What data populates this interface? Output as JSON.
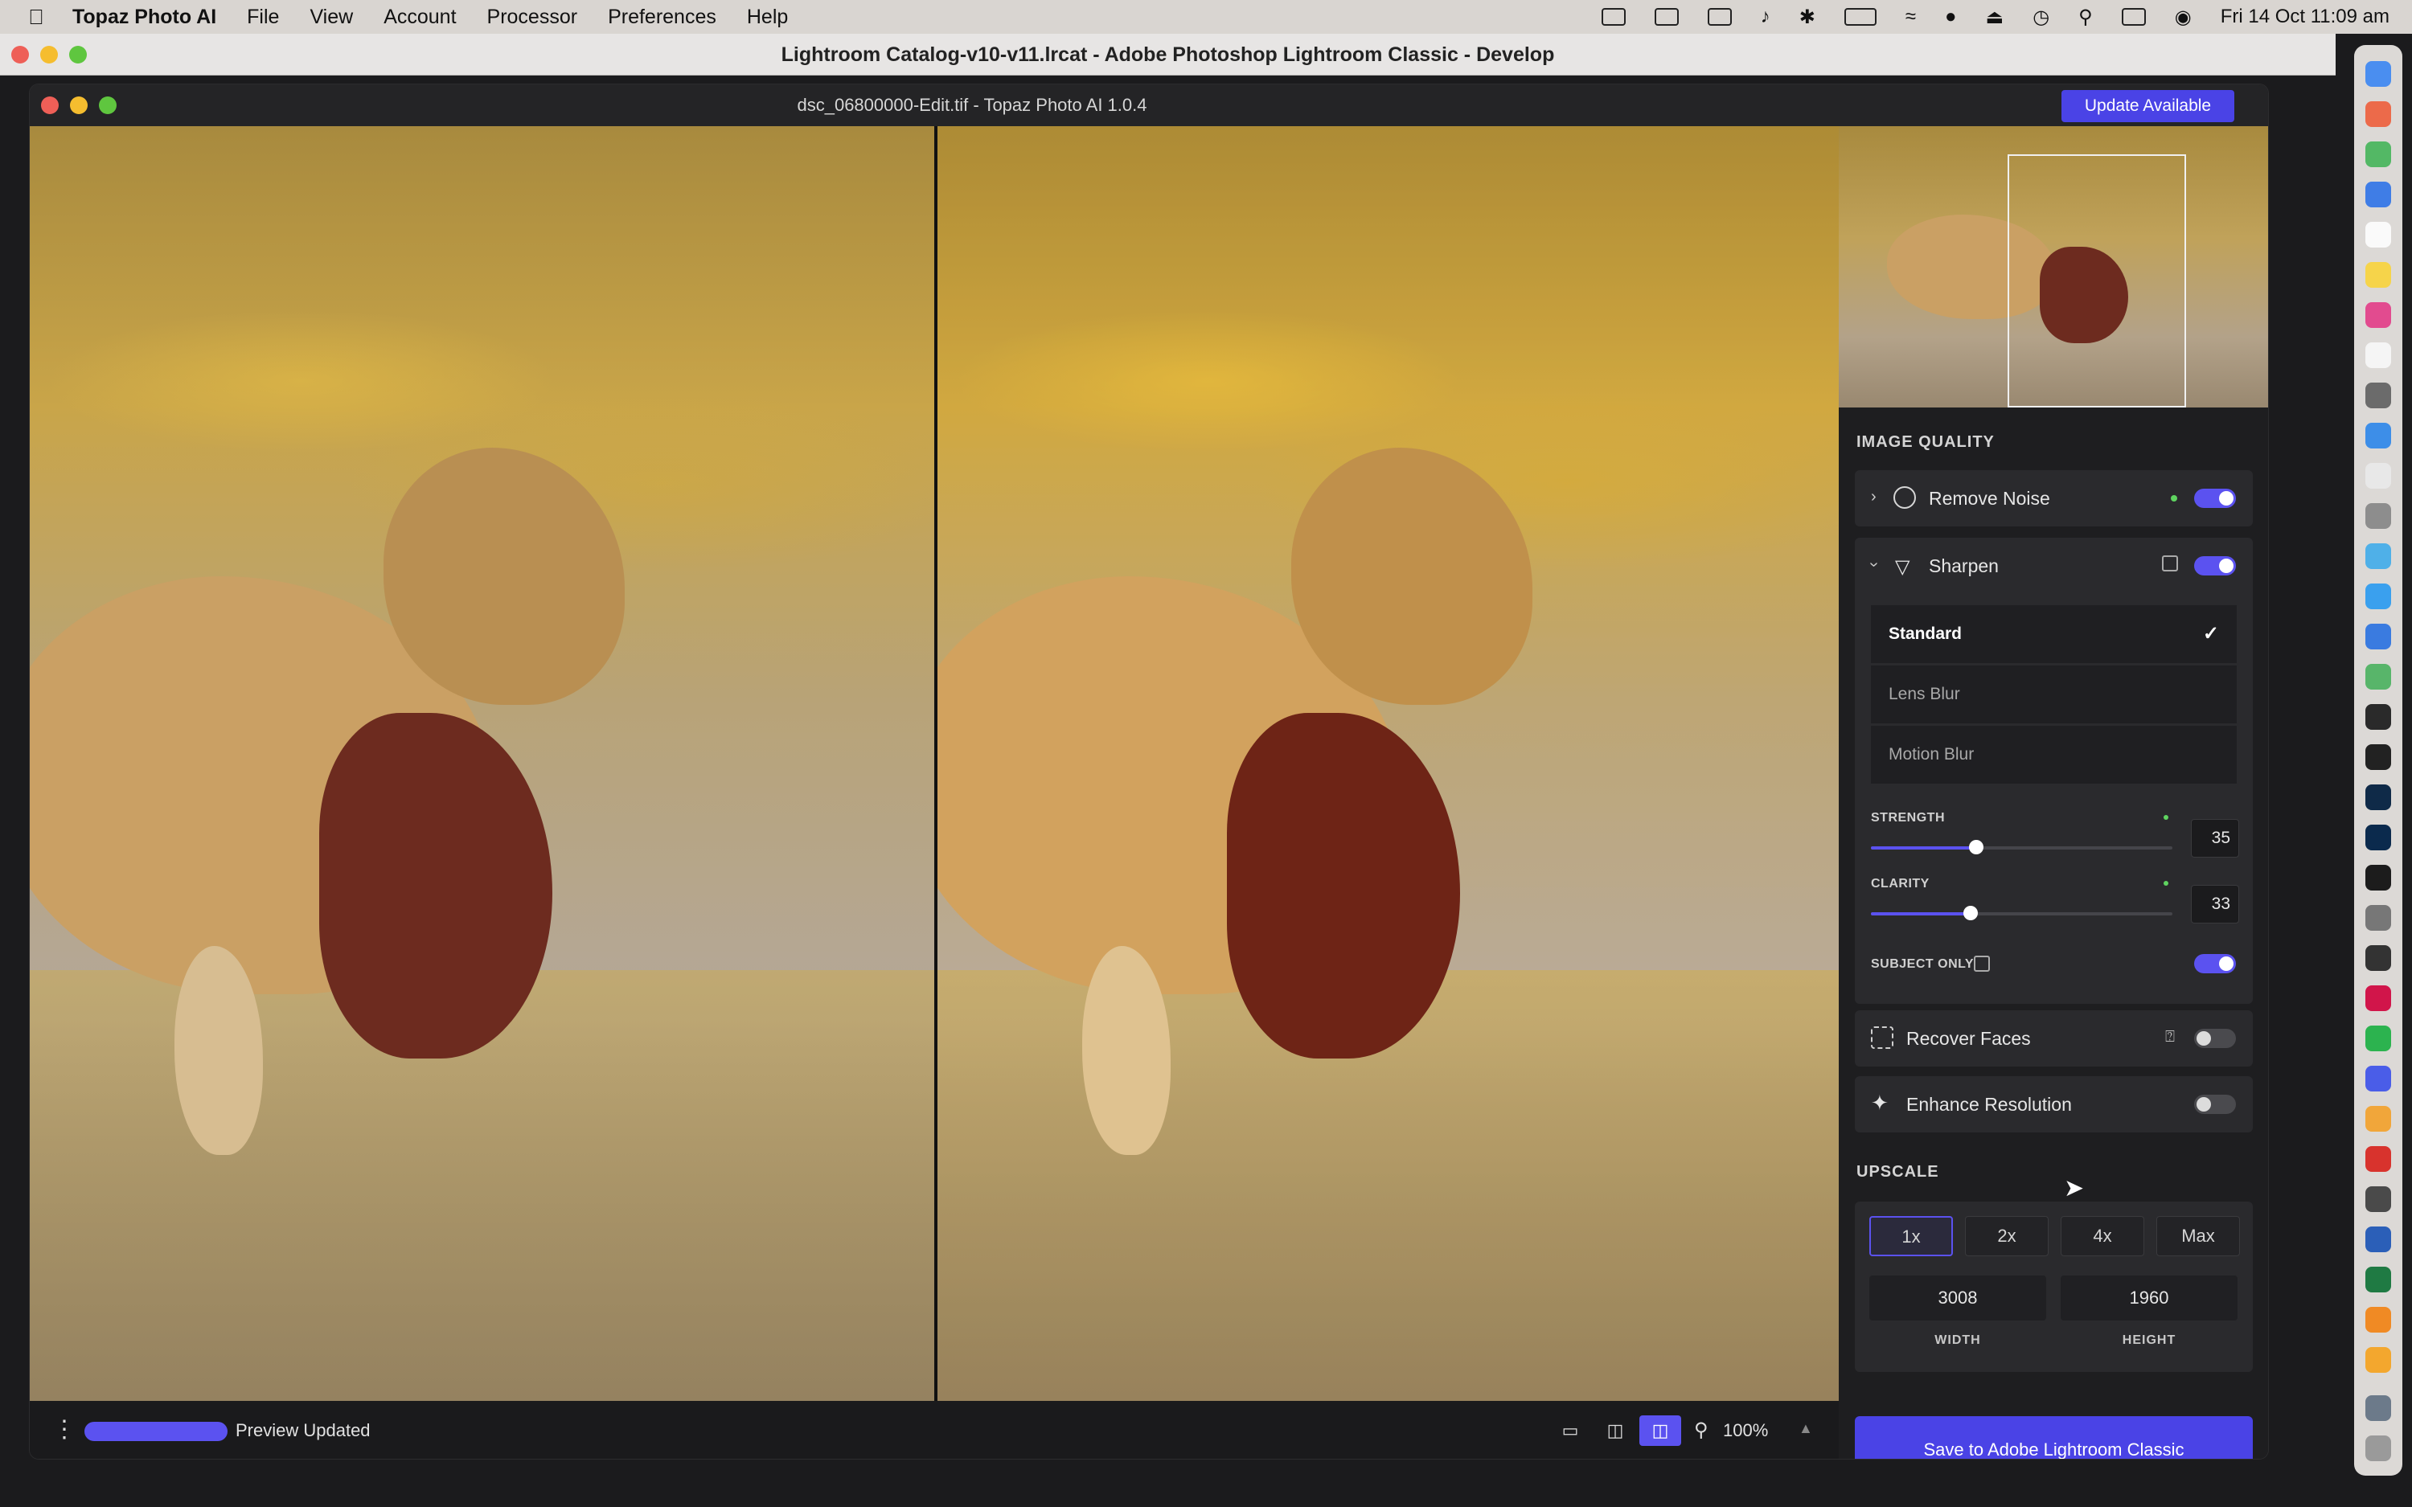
{
  "menubar": {
    "app_name": "Topaz Photo AI",
    "items": [
      "File",
      "View",
      "Account",
      "Processor",
      "Preferences",
      "Help"
    ],
    "datetime": "Fri 14 Oct  11:09 am"
  },
  "host_window": {
    "title": "Lightroom Catalog-v10-v11.lrcat - Adobe Photoshop Lightroom Classic - Develop"
  },
  "topaz": {
    "title": "dsc_06800000-Edit.tif - Topaz Photo AI 1.0.4",
    "update_label": "Update Available",
    "image_quality": {
      "title": "IMAGE QUALITY",
      "remove_noise": {
        "label": "Remove Noise",
        "enabled": true
      },
      "sharpen": {
        "label": "Sharpen",
        "enabled": true,
        "modes": [
          "Standard",
          "Lens Blur",
          "Motion Blur"
        ],
        "selected_mode": "Standard",
        "strength": {
          "label": "STRENGTH",
          "value": "35",
          "fraction": 0.35
        },
        "clarity": {
          "label": "CLARITY",
          "value": "33",
          "fraction": 0.33
        },
        "subject_only": {
          "label": "SUBJECT ONLY",
          "enabled": true
        }
      },
      "recover_faces": {
        "label": "Recover Faces",
        "enabled": false
      },
      "enhance_resolution": {
        "label": "Enhance Resolution",
        "enabled": false
      }
    },
    "upscale": {
      "title": "UPSCALE",
      "options": [
        "1x",
        "2x",
        "4x",
        "Max"
      ],
      "selected": "1x",
      "width": "3008",
      "height": "1960",
      "width_label": "WIDTH",
      "height_label": "HEIGHT"
    },
    "save_label": "Save to Adobe Lightroom Classic",
    "status": {
      "preview_label": "Preview Updated",
      "zoom": "100%"
    }
  },
  "colors": {
    "accent": "#5b52f0",
    "indicator_green": "#5fd460"
  }
}
